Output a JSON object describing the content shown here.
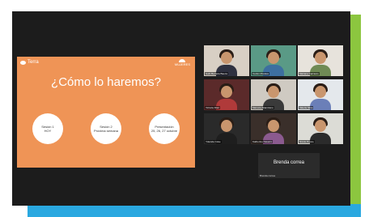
{
  "colors": {
    "frame_green": "#8cc63f",
    "frame_blue": "#2aa8e0",
    "screen_bg": "#1c1c1c",
    "slide_orange": "#ef9456"
  },
  "slide": {
    "logo_left": "Terra",
    "logo_right": "MUJERES",
    "title": "¿Cómo lo haremos?",
    "circles": [
      {
        "line1": "Sesión 1",
        "line2": "HOY"
      },
      {
        "line1": "Sesión 2",
        "line2": "Próxima semana"
      },
      {
        "line1": "Presentación",
        "line2": "25, 26, 27 octubre"
      }
    ]
  },
  "tiles": [
    {
      "name": "Gabi Barraza Baeza",
      "wall": "#d8cfc4",
      "shirt": "#2f3140"
    },
    {
      "name": "Carlos Morales",
      "wall": "#5a9a86",
      "shirt": "#3d6fa0"
    },
    {
      "name": "Mariana Carrasco",
      "wall": "#e7e3dc",
      "shirt": "#6f8a55"
    },
    {
      "name": "Victoria Díaz",
      "wall": "#5b2a2a",
      "shirt": "#b03a3a"
    },
    {
      "name": "Marcela Altamirano",
      "wall": "#cfcac2",
      "shirt": "#3a3a3a"
    },
    {
      "name": "Valeria Silva",
      "wall": "#e4e8ec",
      "shirt": "#6b7fb8"
    },
    {
      "name": "Yolanda Coke",
      "wall": "#2a2a2a",
      "shirt": "#1e1e1e"
    },
    {
      "name": "Katherine Navarro",
      "wall": "#3a2f2a",
      "shirt": "#8b5a8f"
    },
    {
      "name": "Nicole Ponce",
      "wall": "#dcdcd6",
      "shirt": "#2b2b2b"
    }
  ],
  "named_tile": {
    "display_name": "Brenda correa",
    "caption": "Brenda correa"
  }
}
